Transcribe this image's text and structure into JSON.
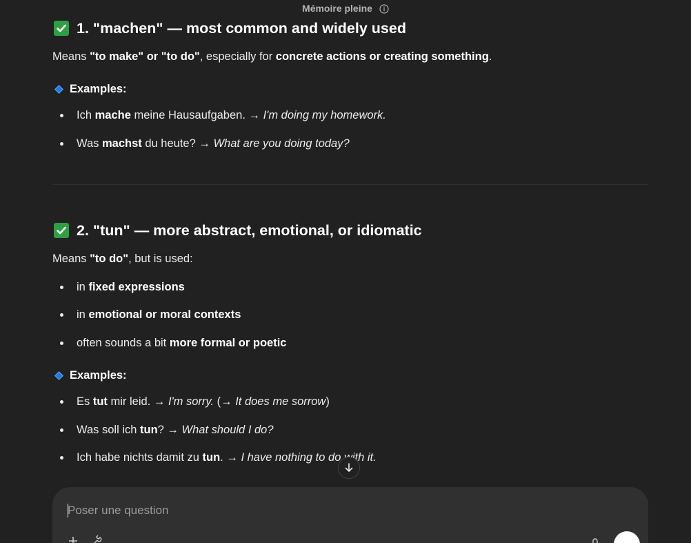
{
  "topbar": {
    "memory_label": "Mémoire pleine",
    "info_icon": "info-icon"
  },
  "section1": {
    "heading": "1. \"machen\" — most common and widely used",
    "lead": {
      "p1": "Means ",
      "b1": "\"to make\" or \"to do\"",
      "p2": ", especially for ",
      "b2": "concrete actions or creating something",
      "p3": "."
    },
    "examples_label": "Examples:",
    "examples": [
      {
        "p1": "Ich ",
        "b": "mache",
        "p2": " meine Hausaufgaben. → ",
        "i": "I'm doing my homework."
      },
      {
        "p1": "Was ",
        "b": "machst",
        "p2": " du heute? → ",
        "i": "What are you doing today?"
      }
    ]
  },
  "section2": {
    "heading": "2. \"tun\" — more abstract, emotional, or idiomatic",
    "lead": {
      "p1": "Means ",
      "b1": "\"to do\"",
      "p2": ", but is used:"
    },
    "uses": [
      {
        "p": "in ",
        "b": "fixed expressions"
      },
      {
        "p": "in ",
        "b": "emotional or moral contexts"
      },
      {
        "p": "often sounds a bit ",
        "b": "more formal or poetic"
      }
    ],
    "examples_label": "Examples:",
    "examples": [
      {
        "p1": "Es ",
        "b": "tut",
        "p2": " mir leid. → ",
        "i1": "I'm sorry.",
        "p3": " (→ ",
        "i2": "It does me sorrow",
        "p4": ")"
      },
      {
        "p1": "Was soll ich ",
        "b": "tun",
        "p2": "? → ",
        "i1": "What should I do?"
      },
      {
        "p1": "Ich habe nichts damit zu ",
        "b": "tun",
        "p2": ". → ",
        "i1": "I have nothing to do with it."
      }
    ]
  },
  "composer": {
    "placeholder": "Poser une question"
  },
  "colors": {
    "background": "#212121",
    "composer": "#303030",
    "check": "#2ea043",
    "diamond": "#1f7ae0"
  }
}
